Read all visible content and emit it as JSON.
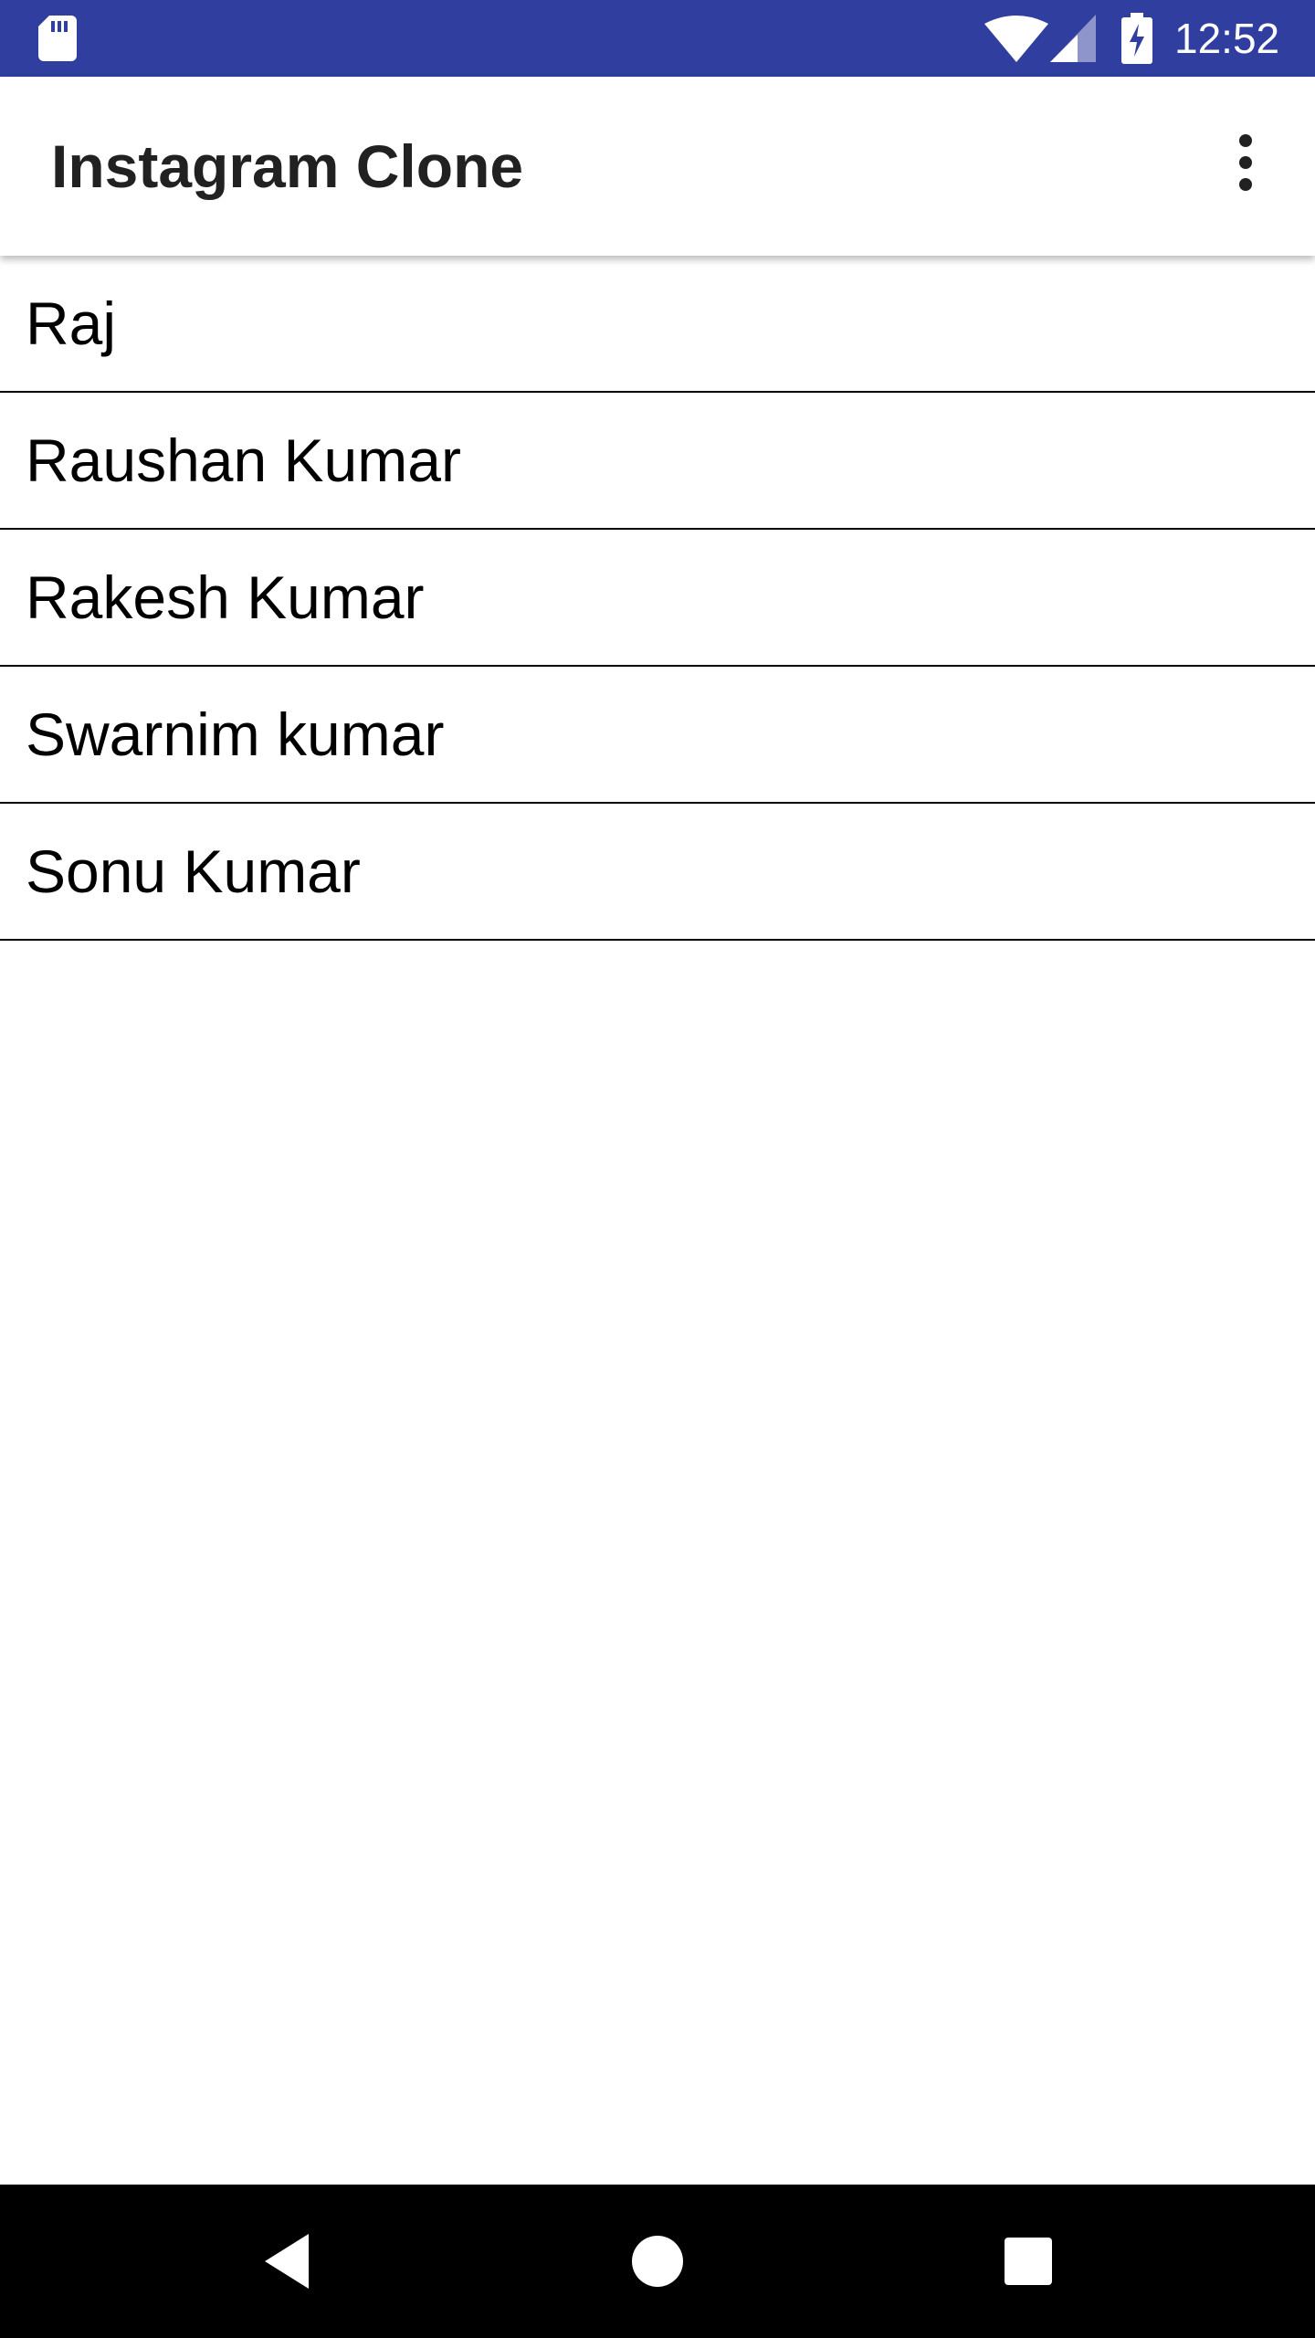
{
  "status_bar": {
    "time": "12:52",
    "icons": [
      "sd-card-icon",
      "wifi-icon",
      "signal-icon",
      "battery-charging-icon"
    ],
    "background_color": "#303f9f"
  },
  "app_bar": {
    "title": "Instagram Clone",
    "menu_icon": "more-vert-icon"
  },
  "users": [
    {
      "name": "Raj"
    },
    {
      "name": "Raushan Kumar"
    },
    {
      "name": "Rakesh Kumar"
    },
    {
      "name": "Swarnim kumar"
    },
    {
      "name": "Sonu Kumar"
    }
  ],
  "nav_bar": {
    "icons": [
      "back-icon",
      "home-icon",
      "recents-icon"
    ]
  }
}
